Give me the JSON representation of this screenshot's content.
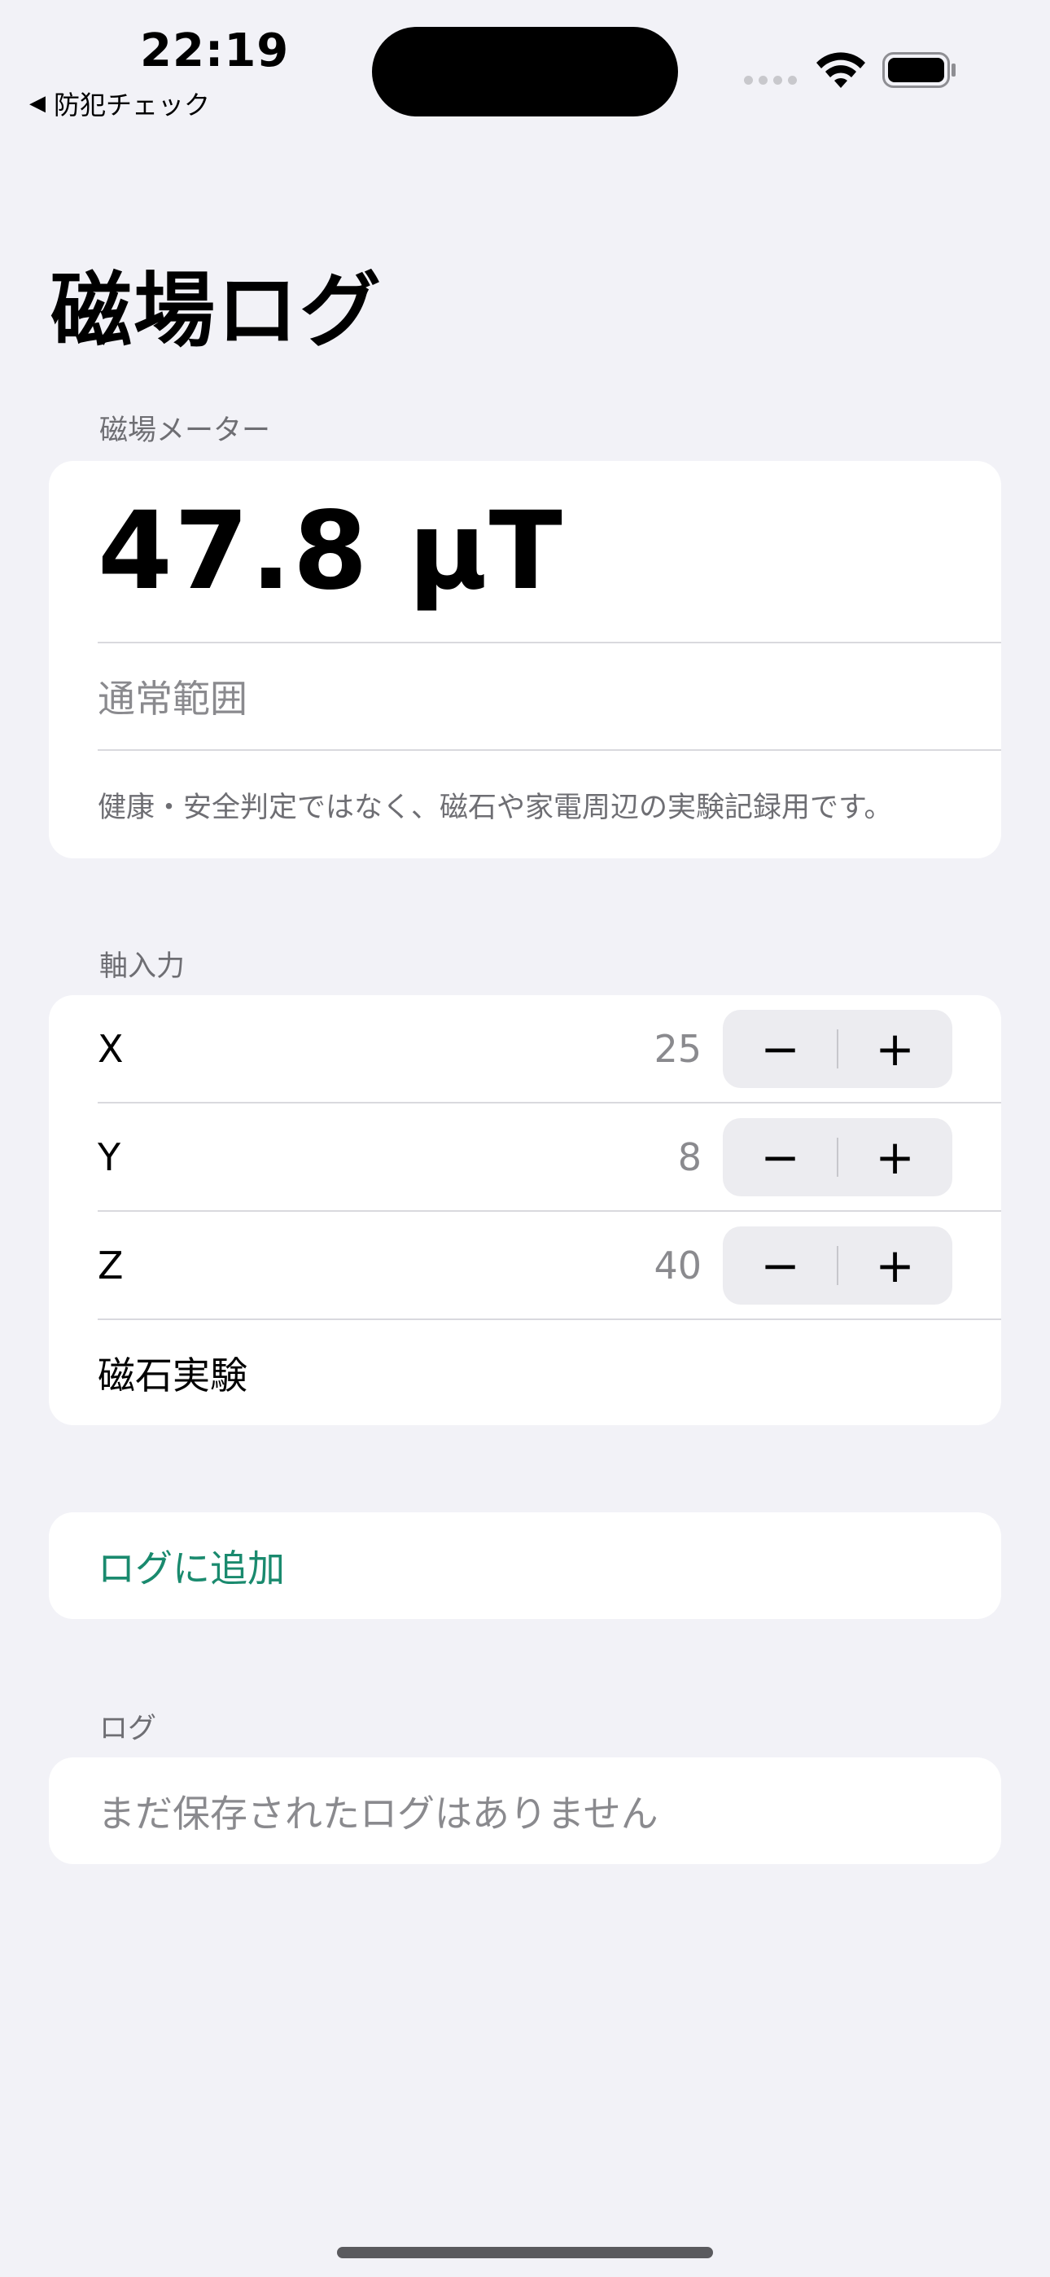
{
  "status_bar": {
    "time": "22:19",
    "back_label": "防犯チェック"
  },
  "page": {
    "title": "磁場ログ"
  },
  "meter": {
    "header": "磁場メーター",
    "reading": "47.8 μT",
    "range_label": "通常範囲",
    "note": "健康・安全判定ではなく、磁石や家電周辺の実験記録用です。"
  },
  "axis": {
    "header": "軸入力",
    "rows": [
      {
        "label": "X",
        "value": "25"
      },
      {
        "label": "Y",
        "value": "8"
      },
      {
        "label": "Z",
        "value": "40"
      }
    ],
    "stepper_minus": "−",
    "stepper_plus": "+",
    "experiment_label": "磁石実験"
  },
  "actions": {
    "add_log": "ログに追加"
  },
  "log": {
    "header": "ログ",
    "empty_message": "まだ保存されたログはありません"
  },
  "colors": {
    "accent": "#1a8a6e",
    "background": "#f2f2f7"
  }
}
